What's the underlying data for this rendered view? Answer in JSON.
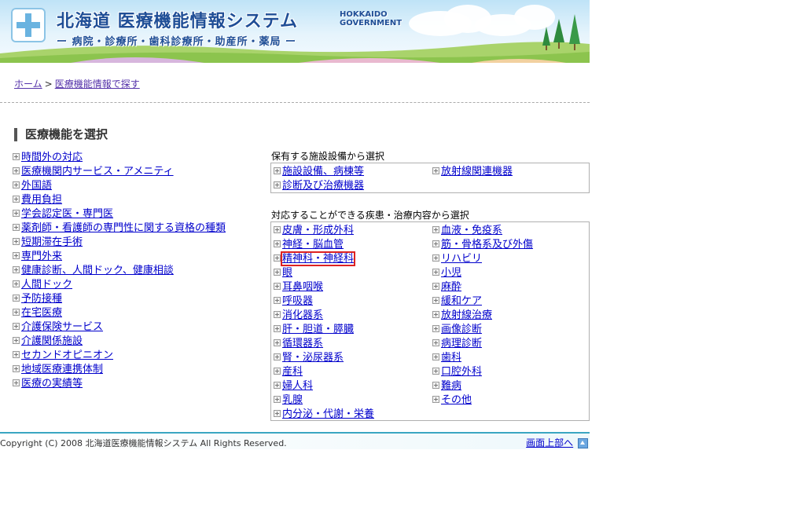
{
  "header": {
    "title": "北海道 医療機能情報システム",
    "title_en_1": "HOKKAIDO",
    "title_en_2": "GOVERNMENT",
    "subtitle": "ー 病院・診療所・歯科診療所・助産所・薬局 ー"
  },
  "breadcrumb": {
    "home": "ホーム",
    "separator": ">",
    "current": "医療機能情報で探す"
  },
  "section_heading": "医療機能を選択",
  "left_items": [
    "時間外の対応",
    "医療機関内サービス・アメニティ",
    "外国語",
    "費用負担",
    "学会認定医・専門医",
    "薬剤師・看護師の専門性に関する資格の種類",
    "短期滞在手術",
    "専門外来",
    "健康診断、人間ドック、健康相談",
    "人間ドック",
    "予防接種",
    "在宅医療",
    "介護保険サービス",
    "介護関係施設",
    "セカンドオピニオン",
    "地域医療連携体制",
    "医療の実績等"
  ],
  "facility": {
    "title": "保有する施設設備から選択",
    "col1": [
      "施設設備、病棟等",
      "診断及び治療機器"
    ],
    "col2": [
      "放射線関連機器"
    ]
  },
  "disease": {
    "title": "対応することができる疾患・治療内容から選択",
    "col1": [
      "皮膚・形成外科",
      "神経・脳血管",
      "精神科・神経科",
      "眼",
      "耳鼻咽喉",
      "呼吸器",
      "消化器系",
      "肝・胆道・膵臓",
      "循環器系",
      "腎・泌尿器系",
      "産科",
      "婦人科",
      "乳腺",
      "内分泌・代謝・栄養"
    ],
    "col2": [
      "血液・免疫系",
      "筋・骨格系及び外傷",
      "リハビリ",
      "小児",
      "麻酔",
      "緩和ケア",
      "放射線治療",
      "画像診断",
      "病理診断",
      "歯科",
      "口腔外科",
      "難病",
      "その他"
    ],
    "highlighted": "精神科・神経科"
  },
  "footer": {
    "copyright": "Copyright (C) 2008 北海道医療機能情報システム All Rights Reserved.",
    "pagetop": "画面上部へ"
  }
}
